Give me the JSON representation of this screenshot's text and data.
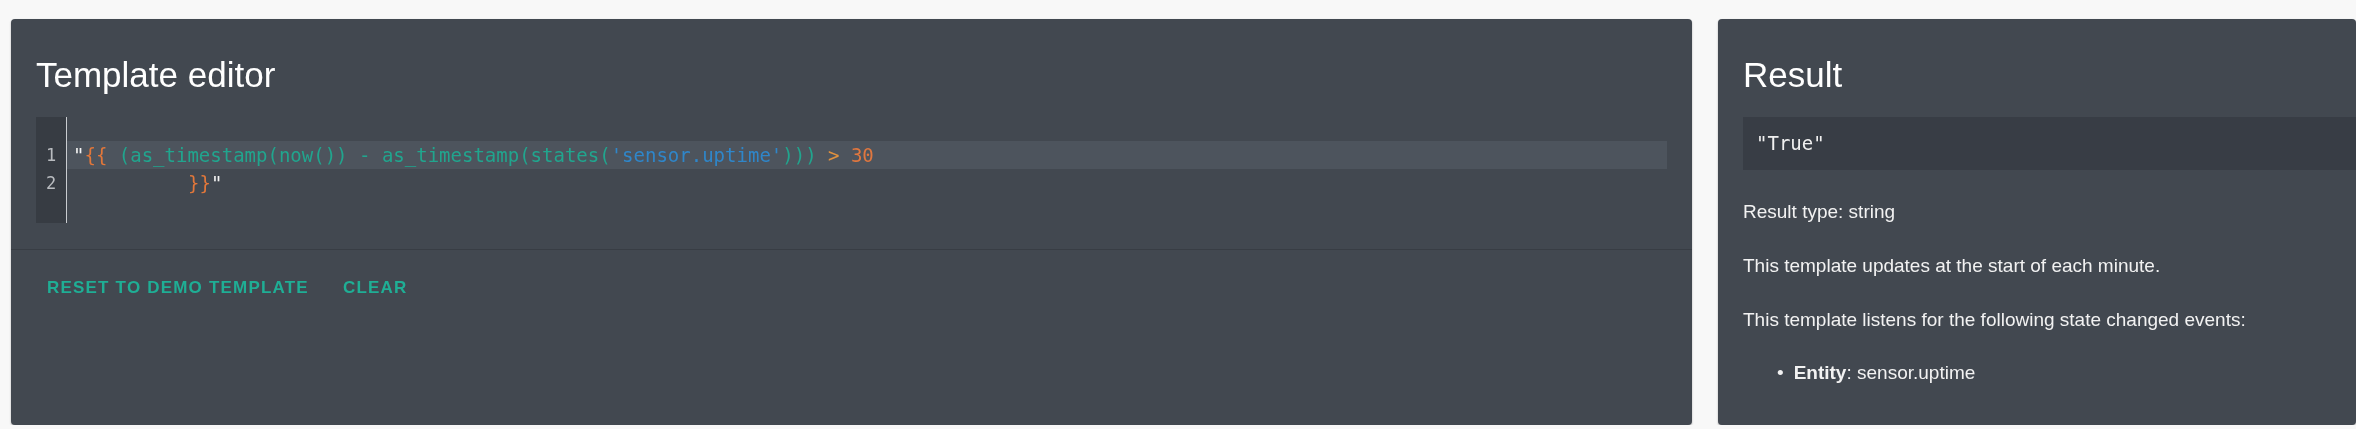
{
  "editor": {
    "title": "Template editor",
    "lines": [
      {
        "number": "1",
        "active": true,
        "tokens": [
          {
            "kind": "quote",
            "text": "\""
          },
          {
            "kind": "brace",
            "text": "{{"
          },
          {
            "kind": "code",
            "text": " (as_timestamp(now()) - as_timestamp(states("
          },
          {
            "kind": "string",
            "text": "'sensor.uptime'"
          },
          {
            "kind": "code",
            "text": "))) "
          },
          {
            "kind": "operator",
            "text": ">"
          },
          {
            "kind": "number",
            "text": " 30"
          }
        ]
      },
      {
        "number": "2",
        "active": false,
        "indented": true,
        "tokens": [
          {
            "kind": "brace",
            "text": "}}"
          },
          {
            "kind": "quote",
            "text": "\""
          }
        ]
      }
    ],
    "actions": [
      "RESET TO DEMO TEMPLATE",
      "CLEAR"
    ]
  },
  "result": {
    "title": "Result",
    "value": "\"True\"",
    "type_line": "Result type: string",
    "update_note": "This template updates at the start of each minute.",
    "listen_note": "This template listens for the following state changed events:",
    "listeners": [
      {
        "marker": "•",
        "text": "**Entity**: sensor.uptime"
      }
    ]
  }
}
